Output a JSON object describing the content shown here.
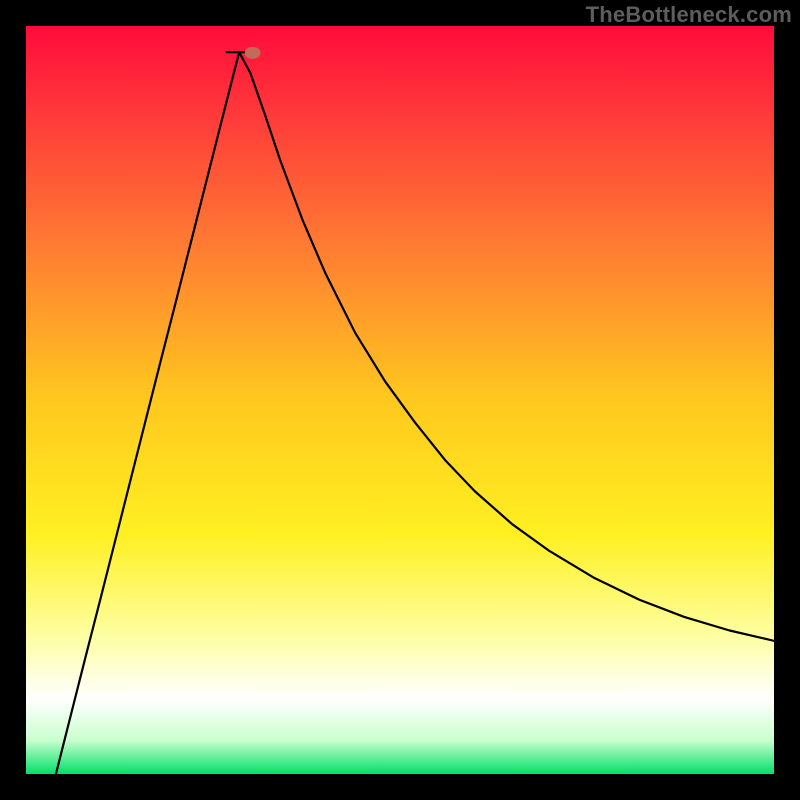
{
  "watermark": "TheBottleneck.com",
  "chart_data": {
    "type": "line",
    "title": "",
    "xlabel": "",
    "ylabel": "",
    "xlim": [
      0,
      1
    ],
    "ylim": [
      0,
      1
    ],
    "background_gradient": {
      "stops": [
        {
          "offset": 0.0,
          "color": "#ff0b3b"
        },
        {
          "offset": 0.12,
          "color": "#ff3a3a"
        },
        {
          "offset": 0.3,
          "color": "#ff7e32"
        },
        {
          "offset": 0.5,
          "color": "#ffc81e"
        },
        {
          "offset": 0.68,
          "color": "#fff022"
        },
        {
          "offset": 0.82,
          "color": "#fdffa6"
        },
        {
          "offset": 0.9,
          "color": "#ffffff"
        },
        {
          "offset": 0.955,
          "color": "#c9ffce"
        },
        {
          "offset": 1.0,
          "color": "#00e06a"
        }
      ]
    },
    "vertex": {
      "x": 0.285,
      "y": 0.965
    },
    "marker": {
      "x": 0.303,
      "y": 0.964,
      "color": "#c36a58"
    },
    "series": [
      {
        "name": "curve",
        "color": "#000000",
        "x": [
          0.04,
          0.06,
          0.08,
          0.1,
          0.12,
          0.14,
          0.16,
          0.18,
          0.2,
          0.22,
          0.24,
          0.26,
          0.275,
          0.285,
          0.3,
          0.32,
          0.34,
          0.37,
          0.4,
          0.44,
          0.48,
          0.52,
          0.56,
          0.6,
          0.65,
          0.7,
          0.76,
          0.82,
          0.88,
          0.94,
          1.0
        ],
        "y": [
          0.0,
          0.079,
          0.158,
          0.236,
          0.315,
          0.394,
          0.473,
          0.552,
          0.63,
          0.709,
          0.788,
          0.867,
          0.926,
          0.965,
          0.937,
          0.88,
          0.82,
          0.74,
          0.67,
          0.59,
          0.525,
          0.47,
          0.42,
          0.378,
          0.334,
          0.298,
          0.262,
          0.233,
          0.21,
          0.192,
          0.178
        ]
      }
    ]
  }
}
